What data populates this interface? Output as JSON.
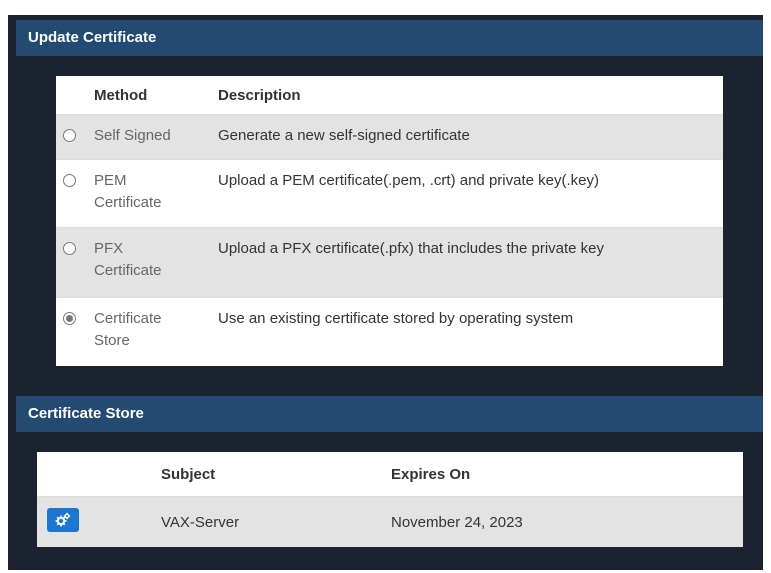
{
  "update_certificate": {
    "header": "Update Certificate",
    "columns": {
      "method": "Method",
      "description": "Description"
    },
    "methods": [
      {
        "label": "Self Signed",
        "description": "Generate a new self-signed certificate",
        "selected": false
      },
      {
        "label": "PEM\nCertificate",
        "description": "Upload a PEM certificate(.pem, .crt) and private key(.key)",
        "selected": false
      },
      {
        "label": "PFX\nCertificate",
        "description": "Upload a PFX certificate(.pfx) that includes the private key",
        "selected": false
      },
      {
        "label": "Certificate\nStore",
        "description": "Use an existing certificate stored by operating system",
        "selected": true
      }
    ]
  },
  "certificate_store": {
    "header": "Certificate Store",
    "columns": {
      "subject": "Subject",
      "expires": "Expires On"
    },
    "rows": [
      {
        "subject": "VAX-Server",
        "expires": "November 24, 2023",
        "action_icon": "gears-icon"
      }
    ]
  },
  "colors": {
    "page_background": "#1b2230",
    "header_background": "#234a73",
    "row_shade": "#e3e3e3",
    "action_button": "#1976d2"
  }
}
